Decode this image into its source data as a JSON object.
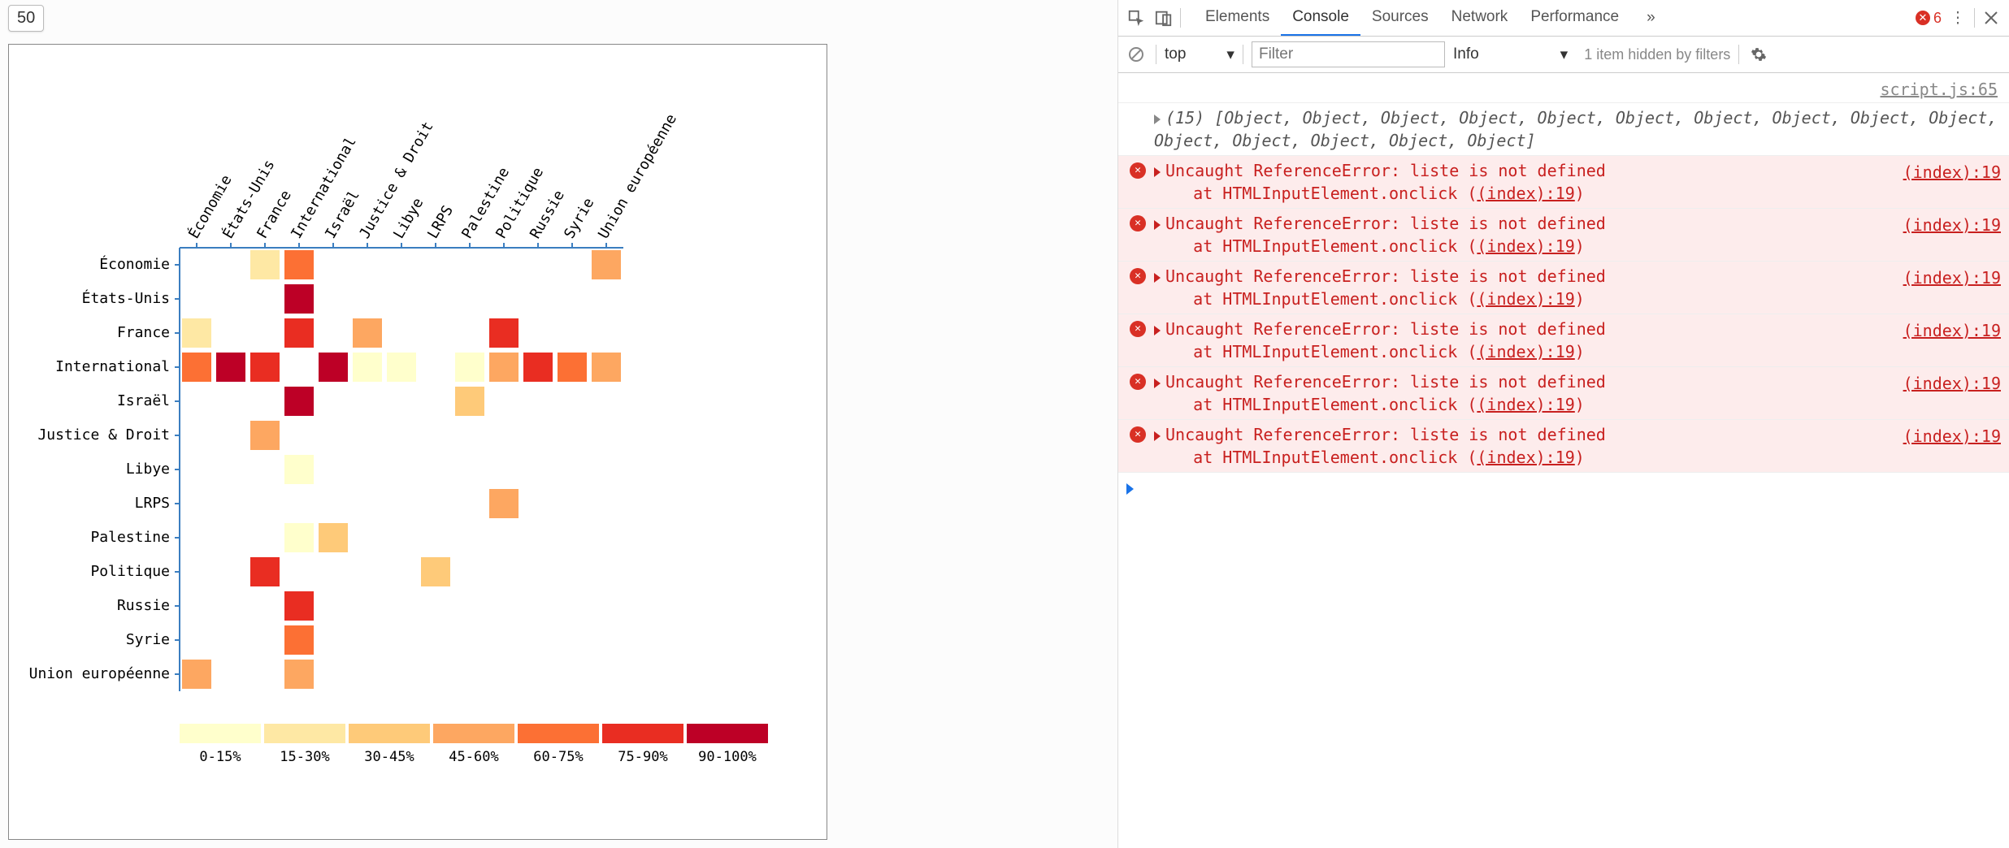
{
  "left": {
    "numInput": "50"
  },
  "devtools": {
    "tabs": [
      "Elements",
      "Console",
      "Sources",
      "Network",
      "Performance"
    ],
    "activeTab": "Console",
    "more": "»",
    "errCount": "6",
    "filterbar": {
      "context": "top",
      "filterPlaceholder": "Filter",
      "level": "Info",
      "hidden": "1 item hidden by filters"
    },
    "srcLink": "script.js:65",
    "arrayPreview": "(15) [Object, Object, Object, Object, Object, Object, Object, Object, Object, Object, Object, Object, Object, Object, Object]",
    "error": {
      "msg": "Uncaught ReferenceError: liste is not defined",
      "stack1": "    at HTMLInputElement.onclick (",
      "stackLink": "(index):19",
      "stack2": ")",
      "src": "(index):19"
    },
    "errorRepeat": 6
  },
  "chart_data": {
    "type": "heatmap",
    "title": "",
    "categories": [
      "Économie",
      "États-Unis",
      "France",
      "International",
      "Israël",
      "Justice & Droit",
      "Libye",
      "LRPS",
      "Palestine",
      "Politique",
      "Russie",
      "Syrie",
      "Union européenne"
    ],
    "legend": {
      "labels": [
        "0-15%",
        "15-30%",
        "30-45%",
        "45-60%",
        "60-75%",
        "75-90%",
        "90-100%"
      ],
      "colors": [
        "#ffffcc",
        "#fee8a4",
        "#feca79",
        "#fda761",
        "#fc7034",
        "#e92d22",
        "#bd0026"
      ]
    },
    "cells": [
      {
        "r": 0,
        "c": 2,
        "bin": 1
      },
      {
        "r": 0,
        "c": 3,
        "bin": 4
      },
      {
        "r": 0,
        "c": 12,
        "bin": 3
      },
      {
        "r": 1,
        "c": 3,
        "bin": 6
      },
      {
        "r": 2,
        "c": 0,
        "bin": 1
      },
      {
        "r": 2,
        "c": 3,
        "bin": 5
      },
      {
        "r": 2,
        "c": 5,
        "bin": 3
      },
      {
        "r": 2,
        "c": 9,
        "bin": 5
      },
      {
        "r": 3,
        "c": 0,
        "bin": 4
      },
      {
        "r": 3,
        "c": 1,
        "bin": 6
      },
      {
        "r": 3,
        "c": 2,
        "bin": 5
      },
      {
        "r": 3,
        "c": 4,
        "bin": 6
      },
      {
        "r": 3,
        "c": 5,
        "bin": 0
      },
      {
        "r": 3,
        "c": 6,
        "bin": 0
      },
      {
        "r": 3,
        "c": 8,
        "bin": 0
      },
      {
        "r": 3,
        "c": 9,
        "bin": 3
      },
      {
        "r": 3,
        "c": 10,
        "bin": 5
      },
      {
        "r": 3,
        "c": 11,
        "bin": 4
      },
      {
        "r": 3,
        "c": 12,
        "bin": 3
      },
      {
        "r": 4,
        "c": 3,
        "bin": 6
      },
      {
        "r": 4,
        "c": 8,
        "bin": 2
      },
      {
        "r": 5,
        "c": 2,
        "bin": 3
      },
      {
        "r": 6,
        "c": 3,
        "bin": 0
      },
      {
        "r": 7,
        "c": 9,
        "bin": 3
      },
      {
        "r": 8,
        "c": 3,
        "bin": 0
      },
      {
        "r": 8,
        "c": 4,
        "bin": 2
      },
      {
        "r": 9,
        "c": 2,
        "bin": 5
      },
      {
        "r": 9,
        "c": 7,
        "bin": 2
      },
      {
        "r": 10,
        "c": 3,
        "bin": 5
      },
      {
        "r": 11,
        "c": 3,
        "bin": 4
      },
      {
        "r": 12,
        "c": 0,
        "bin": 3
      },
      {
        "r": 12,
        "c": 3,
        "bin": 3
      }
    ]
  }
}
